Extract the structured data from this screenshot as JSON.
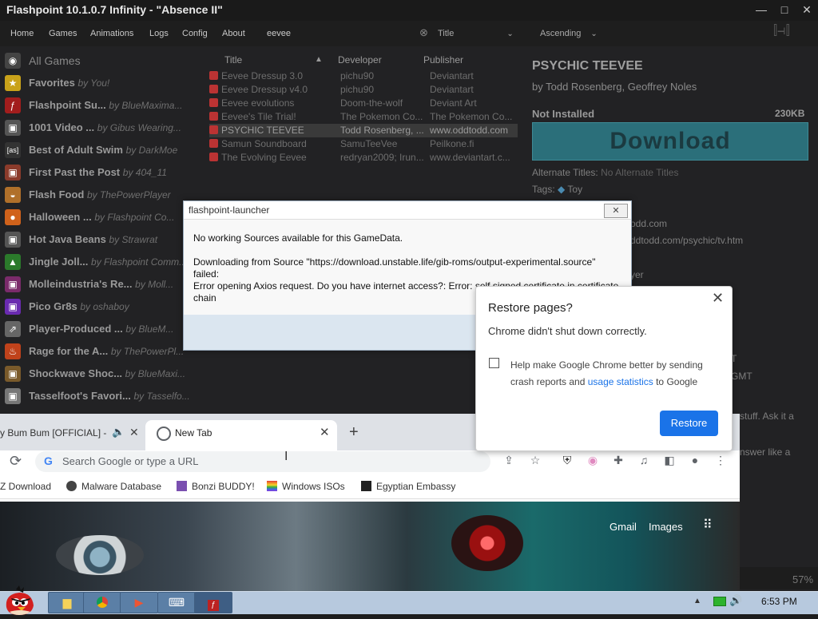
{
  "flashpoint": {
    "title": "Flashpoint 10.1.0.7 Infinity - \"Absence II\"",
    "window_controls": [
      "—",
      "□",
      "✕"
    ],
    "menu": [
      "Home",
      "Games",
      "Animations",
      "Logs",
      "Config",
      "About"
    ],
    "search_value": "eevee",
    "sort_field": "Title",
    "sort_order": "Ascending",
    "sidebar": [
      {
        "label": "All Games",
        "by": "",
        "icon": "eye-icon",
        "color": "#444"
      },
      {
        "label": "Favorites",
        "by": "by You!",
        "icon": "star-icon",
        "color": "#c9a21a"
      },
      {
        "label": "Flashpoint Su...",
        "by": "by BlueMaxima...",
        "icon": "flashpoint-icon",
        "color": "#a21d1d"
      },
      {
        "label": "1001 Video ...",
        "by": "by Gibus Wearing...",
        "icon": "playlist-icon",
        "color": "#555"
      },
      {
        "label": "Best of Adult Swim",
        "by": "by DarkMoe",
        "icon": "as-icon",
        "color": "#333"
      },
      {
        "label": "First Past the Post",
        "by": "by 404_11",
        "icon": "playlist-icon",
        "color": "#8b3b2b"
      },
      {
        "label": "Flash Food",
        "by": "by ThePowerPlayer",
        "icon": "burger-icon",
        "color": "#b0702a"
      },
      {
        "label": "Halloween ...",
        "by": "by Flashpoint Co...",
        "icon": "pumpkin-icon",
        "color": "#d0621b"
      },
      {
        "label": "Hot Java Beans",
        "by": "by Strawrat",
        "icon": "playlist-icon",
        "color": "#555"
      },
      {
        "label": "Jingle Joll...",
        "by": "by Flashpoint Comm...",
        "icon": "tree-icon",
        "color": "#2b7a2b"
      },
      {
        "label": "Molleindustria's Re...",
        "by": "by Moll...",
        "icon": "playlist-icon",
        "color": "#7a2b6a"
      },
      {
        "label": "Pico Gr8s",
        "by": "by oshaboy",
        "icon": "playlist-icon",
        "color": "#6a2bb0"
      },
      {
        "label": "Player-Produced ...",
        "by": "by BlueM...",
        "icon": "share-icon",
        "color": "#666"
      },
      {
        "label": "Rage for the A...",
        "by": "by ThePowerPl...",
        "icon": "fire-icon",
        "color": "#c0421b"
      },
      {
        "label": "Shockwave Shoc...",
        "by": "by BlueMaxi...",
        "icon": "playlist-icon",
        "color": "#7a5a2b"
      },
      {
        "label": "Tasselfoot's Favori...",
        "by": "by Tasselfo...",
        "icon": "playlist-icon",
        "color": "#777"
      }
    ],
    "list_headers": {
      "title": "Title",
      "developer": "Developer",
      "publisher": "Publisher"
    },
    "games": [
      {
        "title": "Eevee Dressup 3.0",
        "developer": "pichu90",
        "publisher": "Deviantart"
      },
      {
        "title": "Eevee Dressup v4.0",
        "developer": "pichu90",
        "publisher": "Deviantart"
      },
      {
        "title": "Eevee evolutions",
        "developer": "Doom-the-wolf",
        "publisher": "Deviant Art"
      },
      {
        "title": "Eevee's Tile Trial!",
        "developer": "The Pokemon Co...",
        "publisher": "The Pokemon Co..."
      },
      {
        "title": "PSYCHIC TEEVEE",
        "developer": "Todd Rosenberg, ...",
        "publisher": "www.oddtodd.com"
      },
      {
        "title": "Samun Soundboard",
        "developer": "SamuTeeVee",
        "publisher": "Peilkone.fi"
      },
      {
        "title": "The Evolving Eevee",
        "developer": "redryan2009; Irun...",
        "publisher": "www.deviantart.c..."
      }
    ],
    "detail": {
      "title": "PSYCHIC TEEVEE",
      "by": "by Todd Rosenberg, Geoffrey Noles",
      "status": "Not Installed",
      "size": "230KB",
      "download_label": "Download",
      "alt_label": "Alternate Titles:",
      "alt_value": "No Alternate Titles",
      "tags_label": "Tags:",
      "tag": "Toy",
      "frag1": "odd.com",
      "frag2": "ddtodd.com/psychic/tv.htm",
      "frag3": "yer",
      "frag4": "T",
      "frag5": "GMT",
      "frag6": "stuff. Ask it a",
      "frag7": "nswer like a"
    },
    "zoom": "57%"
  },
  "launcher_dialog": {
    "title": "flashpoint-launcher",
    "close": "✕",
    "line1": "No working Sources available for this GameData.",
    "line2": "Downloading from Source \"https://download.unstable.life/gib-roms/output-experimental.source\"",
    "line3": "failed:",
    "line4": " Error opening Axios request. Do you have internet access?: Error: self signed certificate in certificate",
    "line5": "chain"
  },
  "chrome": {
    "tab1_label": "y Bum Bum [OFFICIAL] -",
    "tab1_audio": "🔈",
    "tab1_close": "✕",
    "tab2_label": "New Tab",
    "tab2_close": "✕",
    "new_tab": "+",
    "reload": "⟳",
    "omnibox_placeholder": "Search Google or type a URL",
    "bookmarks": [
      {
        "label": "Z Download",
        "color": "#2a2a2a"
      },
      {
        "label": "Malware Database",
        "color": "#444"
      },
      {
        "label": "Bonzi BUDDY!",
        "color": "#7a4fb0"
      },
      {
        "label": "Windows ISOs",
        "color": "#e03a3a"
      },
      {
        "label": "Egyptian Embassy",
        "color": "#222"
      }
    ],
    "gmail": "Gmail",
    "images": "Images",
    "apps_icon": "∷"
  },
  "restore_popup": {
    "title": "Restore pages?",
    "close": "✕",
    "message": "Chrome didn't shut down correctly.",
    "help_pre": "Help make Google Chrome better by sending crash reports and ",
    "help_link": "usage statistics",
    "help_post": " to Google",
    "button": "Restore"
  },
  "taskbar": {
    "buttons": [
      "explorer-icon",
      "chrome-icon",
      "media-icon",
      "keyboard-icon",
      "flashpoint-icon"
    ],
    "time": "6:53 PM",
    "tray_up": "▲",
    "volume": "🔊"
  }
}
